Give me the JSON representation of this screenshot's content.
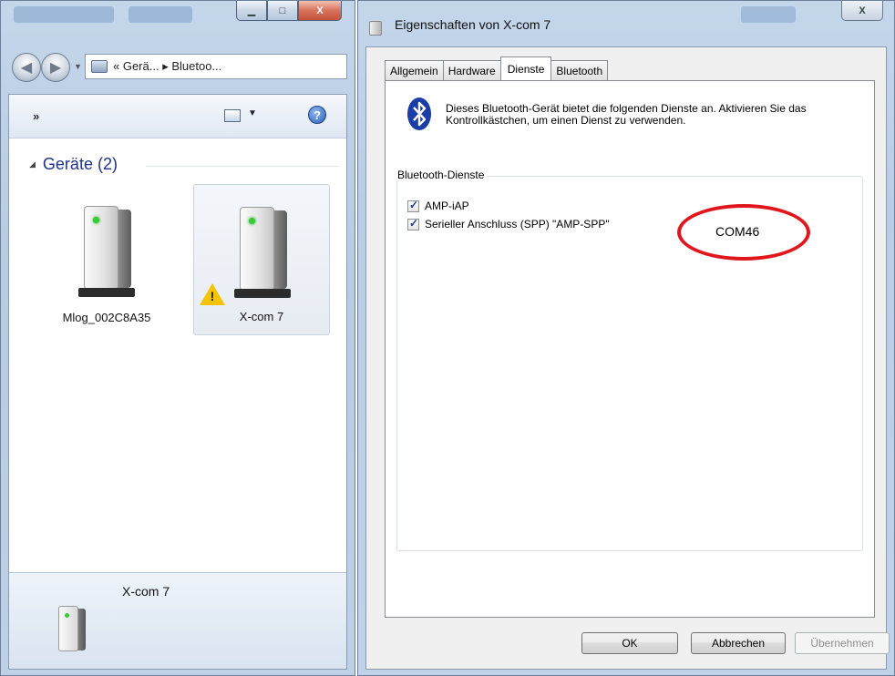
{
  "explorer": {
    "breadcrumb": "« Gerä... ▸ Bluetoo...",
    "toolbar": {
      "more": "»",
      "help": "?"
    },
    "group": {
      "title": "Geräte (2)"
    },
    "devices": [
      {
        "name": "Mlog_002C8A35"
      },
      {
        "name": "X-com 7"
      }
    ],
    "details": {
      "name": "X-com 7"
    },
    "caption": {
      "minimize": "▁",
      "maximize": "□",
      "close": "X"
    }
  },
  "dialog": {
    "title": "Eigenschaften von X-com 7",
    "close": "X",
    "tabs": [
      "Allgemein",
      "Hardware",
      "Dienste",
      "Bluetooth"
    ],
    "active_tab": "Dienste",
    "description": "Dieses Bluetooth-Gerät bietet die folgenden Dienste an. Aktivieren Sie das Kontrollkästchen, um einen Dienst zu verwenden.",
    "services_legend": "Bluetooth-Dienste",
    "services": [
      {
        "label": "AMP-iAP",
        "checked": true
      },
      {
        "label": "Serieller Anschluss (SPP) \"AMP-SPP\"",
        "checked": true
      }
    ],
    "com_port": "COM46",
    "buttons": {
      "ok": "OK",
      "cancel": "Abbrechen",
      "apply": "Übernehmen"
    }
  },
  "colors": {
    "highlight_ring": "#e0161c",
    "bluetooth": "#1a3da6"
  }
}
